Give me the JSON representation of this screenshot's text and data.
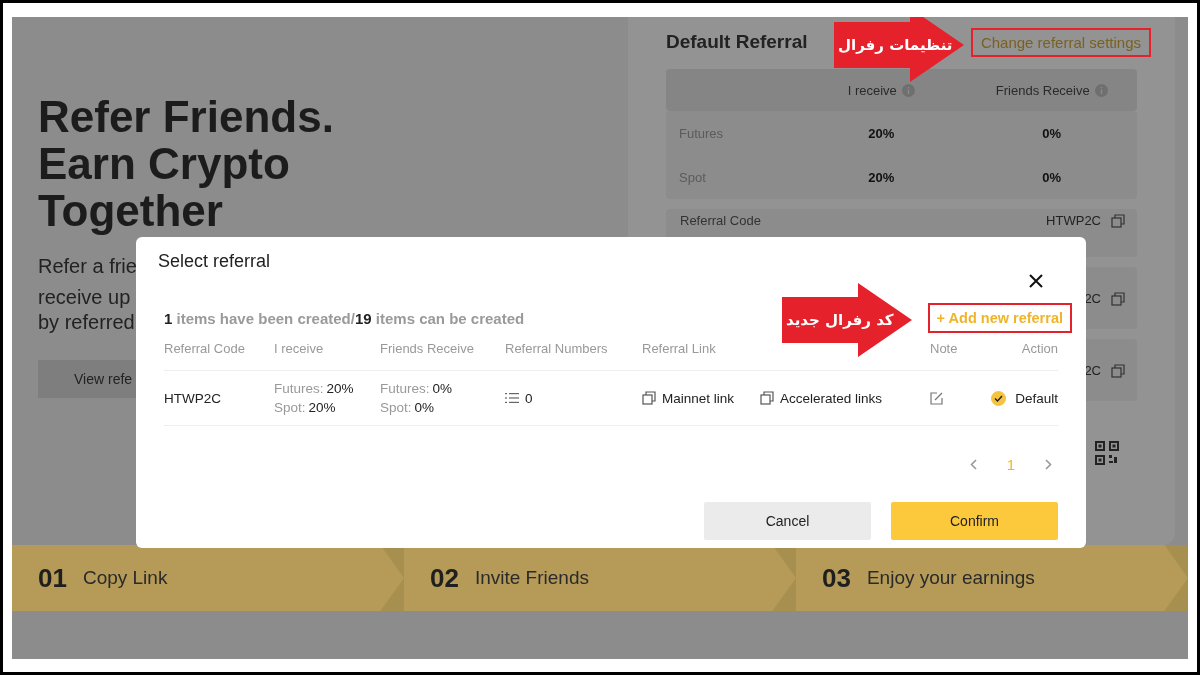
{
  "page": {
    "hero": {
      "title_lines": [
        "Refer Friends.",
        "Earn Crypto",
        "Together"
      ],
      "subtitle_lines": [
        "Refer a frie",
        "receive up",
        "by referred"
      ],
      "button": "View refe"
    },
    "default_referral": {
      "title": "Default Referral",
      "settings_link": {
        "label": "Change referral settings",
        "highlighted": true
      },
      "columns": [
        "I receive",
        "Friends Receive"
      ],
      "rows": [
        {
          "label": "Futures",
          "i_receive": "20%",
          "friends_receive": "0%"
        },
        {
          "label": "Spot",
          "i_receive": "20%",
          "friends_receive": "0%"
        }
      ],
      "code_label": "Referral Code",
      "code_value": "HTWP2C",
      "link_rows": [
        "2C",
        "2C"
      ]
    },
    "steps": [
      {
        "number": "01",
        "label": "Copy Link"
      },
      {
        "number": "02",
        "label": "Invite Friends"
      },
      {
        "number": "03",
        "label": "Enjoy your earnings"
      }
    ]
  },
  "modal": {
    "title": "Select referral",
    "summary": {
      "created": "1",
      "created_text": " items have been created/",
      "total": "19",
      "total_text": " items can be created"
    },
    "add_button": {
      "label": "+ Add new referral",
      "highlighted": true
    },
    "columns": [
      "Referral Code",
      "I receive",
      "Friends Receive",
      "Referral Numbers",
      "Referral Link",
      "Note",
      "Action"
    ],
    "rows": [
      {
        "code": "HTWP2C",
        "i_receive": [
          {
            "label": "Futures:",
            "value": "20%"
          },
          {
            "label": "Spot:",
            "value": "20%"
          }
        ],
        "friends_receive": [
          {
            "label": "Futures:",
            "value": "0%"
          },
          {
            "label": "Spot:",
            "value": "0%"
          }
        ],
        "referral_numbers": "0",
        "links": [
          "Mainnet link",
          "Accelerated links"
        ],
        "action": "Default",
        "is_default": true
      }
    ],
    "pages": [
      {
        "label": "1",
        "selected": true
      }
    ],
    "buttons": [
      {
        "label": "Cancel",
        "kind": "secondary"
      },
      {
        "label": "Confirm",
        "kind": "primary"
      }
    ]
  },
  "annotations": [
    {
      "text": "تنظیمات رفرال"
    },
    {
      "text": "کد رفرال جدید"
    }
  ]
}
